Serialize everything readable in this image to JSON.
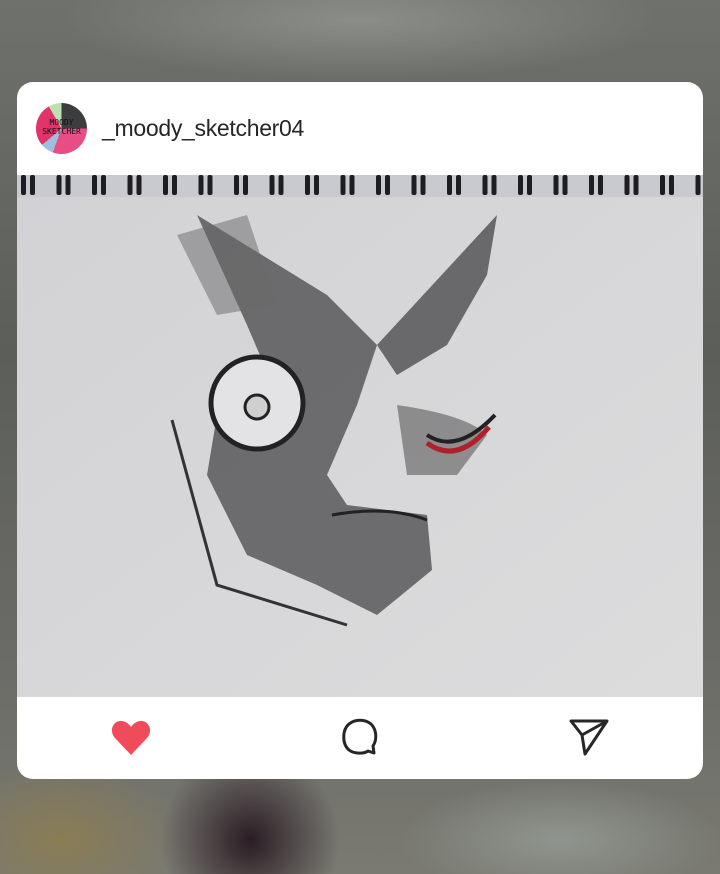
{
  "post": {
    "username": "_moody_sketcher04",
    "avatar_text": [
      "MOODY",
      "SKETCHER"
    ],
    "image_alt": "Pencil sketch of a face on spiral notebook paper",
    "liked": true,
    "actions": [
      {
        "icon": "heart-icon",
        "color": "#f04b5a"
      },
      {
        "icon": "comment-icon",
        "color": "#262626"
      },
      {
        "icon": "share-icon",
        "color": "#262626"
      }
    ]
  }
}
